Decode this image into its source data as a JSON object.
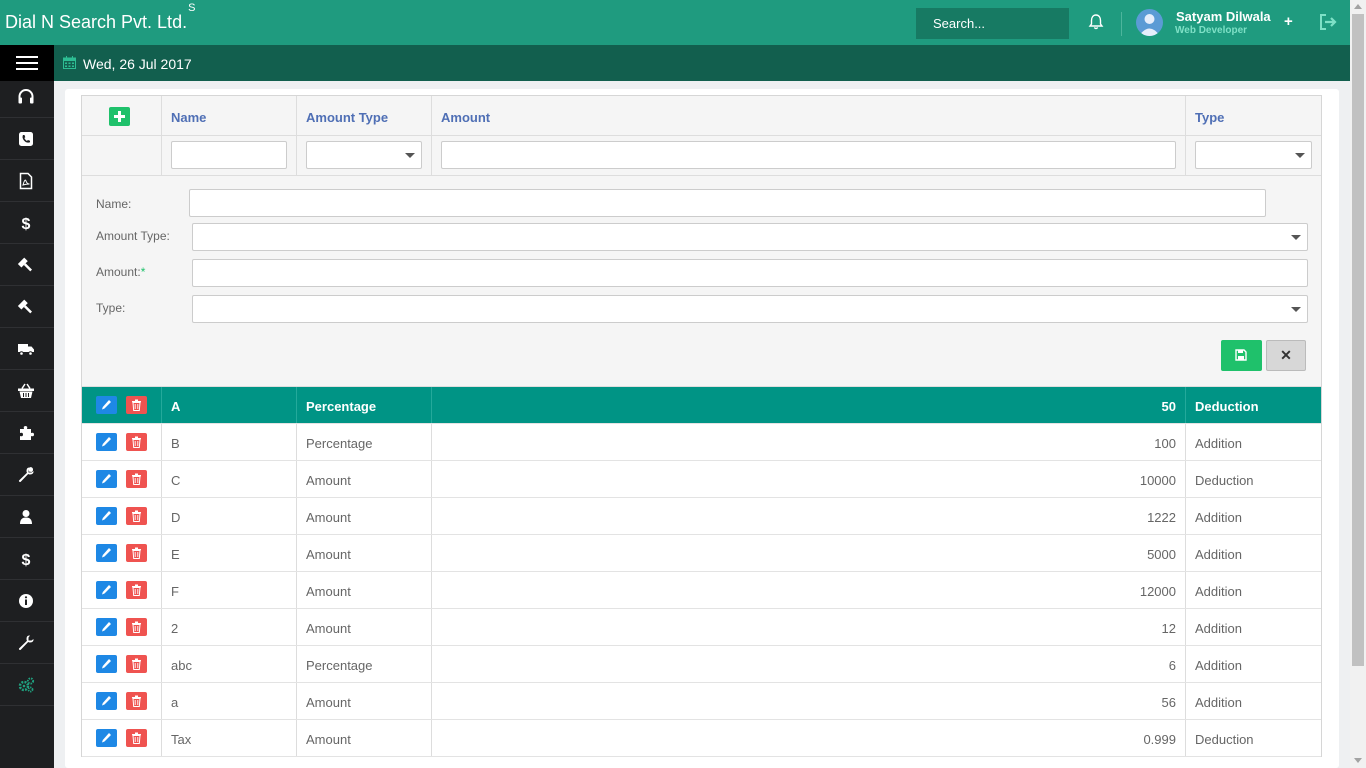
{
  "header": {
    "brand": "Dial N Search Pvt. Ltd.",
    "brand_sup": "S",
    "search_placeholder": "Search...",
    "user_name": "Satyam Dilwala",
    "user_role": "Web Developer",
    "plus": "+"
  },
  "subbar": {
    "date": "Wed, 26 Jul 2017"
  },
  "sidebar": {
    "icons": [
      "headset-icon",
      "phone-icon",
      "pdf-file-icon",
      "dollar-icon",
      "gavel-icon",
      "gavel-icon",
      "truck-icon",
      "basket-icon",
      "puzzle-icon",
      "wrench-icon",
      "user-icon",
      "dollar-icon",
      "info-icon",
      "wrench-icon",
      "gears-icon"
    ]
  },
  "grid": {
    "columns": [
      "Name",
      "Amount Type",
      "Amount",
      "Type"
    ],
    "form": {
      "name_label": "Name:",
      "amount_type_label": "Amount Type:",
      "amount_label": "Amount:",
      "amount_required": "*",
      "type_label": "Type:",
      "cancel_label": "✕"
    },
    "rows": [
      {
        "name": "A",
        "amount_type": "Percentage",
        "amount": "50",
        "type": "Deduction"
      },
      {
        "name": "B",
        "amount_type": "Percentage",
        "amount": "100",
        "type": "Addition"
      },
      {
        "name": "C",
        "amount_type": "Amount",
        "amount": "10000",
        "type": "Deduction"
      },
      {
        "name": "D",
        "amount_type": "Amount",
        "amount": "1222",
        "type": "Addition"
      },
      {
        "name": "E",
        "amount_type": "Amount",
        "amount": "5000",
        "type": "Addition"
      },
      {
        "name": "F",
        "amount_type": "Amount",
        "amount": "12000",
        "type": "Addition"
      },
      {
        "name": "2",
        "amount_type": "Amount",
        "amount": "12",
        "type": "Addition"
      },
      {
        "name": "abc",
        "amount_type": "Percentage",
        "amount": "6",
        "type": "Addition"
      },
      {
        "name": "a",
        "amount_type": "Amount",
        "amount": "56",
        "type": "Addition"
      },
      {
        "name": "Tax",
        "amount_type": "Amount",
        "amount": "0.999",
        "type": "Deduction"
      }
    ]
  },
  "colors": {
    "topbar": "#1f9b7f",
    "subbar": "#125f4e",
    "selected_row": "#009485",
    "add_green": "#1fc16b",
    "edit_blue": "#1e88e5",
    "delete_red": "#ef5350"
  }
}
